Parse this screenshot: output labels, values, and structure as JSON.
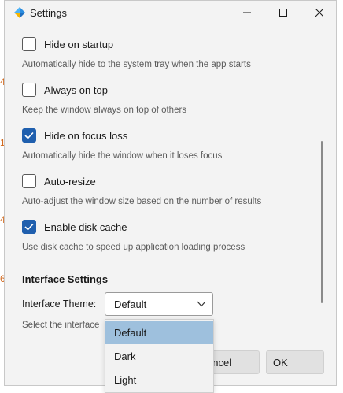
{
  "background_margin_numbers": [
    "4",
    "1",
    "4",
    "6"
  ],
  "window": {
    "title": "Settings",
    "app_icon": "app-logo-icon",
    "controls": [
      "minimize-icon",
      "maximize-icon",
      "close-icon"
    ]
  },
  "options": [
    {
      "label": "Hide on startup",
      "checked": false,
      "description": "Automatically hide to the system tray when the app starts"
    },
    {
      "label": "Always on top",
      "checked": false,
      "description": "Keep the window always on top of others"
    },
    {
      "label": "Hide on focus loss",
      "checked": true,
      "description": "Automatically hide the window when it loses focus"
    },
    {
      "label": "Auto-resize",
      "checked": false,
      "description": "Auto-adjust the window size based on the number of results"
    },
    {
      "label": "Enable disk cache",
      "checked": true,
      "description": "Use disk cache to speed up application loading process"
    }
  ],
  "interface": {
    "section_title": "Interface Settings",
    "theme_label": "Interface Theme:",
    "theme_value": "Default",
    "theme_description": "Select the interface",
    "theme_options": [
      "Default",
      "Dark",
      "Light"
    ],
    "selected_option": "Default"
  },
  "buttons": {
    "cancel_label": "ancel",
    "ok_label": "OK"
  },
  "colors": {
    "accent": "#1f5fae",
    "dropdown_selected": "#9ec0dd",
    "window_bg": "#f3f3f3"
  }
}
